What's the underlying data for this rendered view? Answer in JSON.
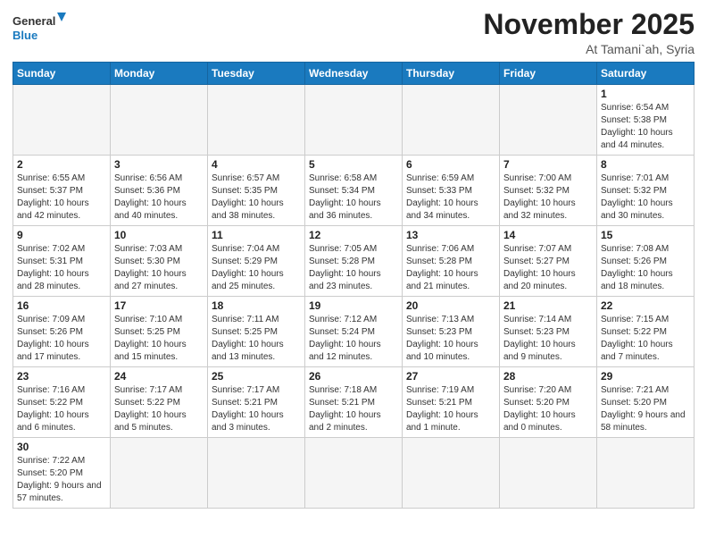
{
  "logo": {
    "line1": "General",
    "line2": "Blue"
  },
  "title": "November 2025",
  "location": "At Tamani`ah, Syria",
  "weekdays": [
    "Sunday",
    "Monday",
    "Tuesday",
    "Wednesday",
    "Thursday",
    "Friday",
    "Saturday"
  ],
  "weeks": [
    [
      {
        "day": "",
        "info": ""
      },
      {
        "day": "",
        "info": ""
      },
      {
        "day": "",
        "info": ""
      },
      {
        "day": "",
        "info": ""
      },
      {
        "day": "",
        "info": ""
      },
      {
        "day": "",
        "info": ""
      },
      {
        "day": "1",
        "info": "Sunrise: 6:54 AM\nSunset: 5:38 PM\nDaylight: 10 hours and 44 minutes."
      }
    ],
    [
      {
        "day": "2",
        "info": "Sunrise: 6:55 AM\nSunset: 5:37 PM\nDaylight: 10 hours and 42 minutes."
      },
      {
        "day": "3",
        "info": "Sunrise: 6:56 AM\nSunset: 5:36 PM\nDaylight: 10 hours and 40 minutes."
      },
      {
        "day": "4",
        "info": "Sunrise: 6:57 AM\nSunset: 5:35 PM\nDaylight: 10 hours and 38 minutes."
      },
      {
        "day": "5",
        "info": "Sunrise: 6:58 AM\nSunset: 5:34 PM\nDaylight: 10 hours and 36 minutes."
      },
      {
        "day": "6",
        "info": "Sunrise: 6:59 AM\nSunset: 5:33 PM\nDaylight: 10 hours and 34 minutes."
      },
      {
        "day": "7",
        "info": "Sunrise: 7:00 AM\nSunset: 5:32 PM\nDaylight: 10 hours and 32 minutes."
      },
      {
        "day": "8",
        "info": "Sunrise: 7:01 AM\nSunset: 5:32 PM\nDaylight: 10 hours and 30 minutes."
      }
    ],
    [
      {
        "day": "9",
        "info": "Sunrise: 7:02 AM\nSunset: 5:31 PM\nDaylight: 10 hours and 28 minutes."
      },
      {
        "day": "10",
        "info": "Sunrise: 7:03 AM\nSunset: 5:30 PM\nDaylight: 10 hours and 27 minutes."
      },
      {
        "day": "11",
        "info": "Sunrise: 7:04 AM\nSunset: 5:29 PM\nDaylight: 10 hours and 25 minutes."
      },
      {
        "day": "12",
        "info": "Sunrise: 7:05 AM\nSunset: 5:28 PM\nDaylight: 10 hours and 23 minutes."
      },
      {
        "day": "13",
        "info": "Sunrise: 7:06 AM\nSunset: 5:28 PM\nDaylight: 10 hours and 21 minutes."
      },
      {
        "day": "14",
        "info": "Sunrise: 7:07 AM\nSunset: 5:27 PM\nDaylight: 10 hours and 20 minutes."
      },
      {
        "day": "15",
        "info": "Sunrise: 7:08 AM\nSunset: 5:26 PM\nDaylight: 10 hours and 18 minutes."
      }
    ],
    [
      {
        "day": "16",
        "info": "Sunrise: 7:09 AM\nSunset: 5:26 PM\nDaylight: 10 hours and 17 minutes."
      },
      {
        "day": "17",
        "info": "Sunrise: 7:10 AM\nSunset: 5:25 PM\nDaylight: 10 hours and 15 minutes."
      },
      {
        "day": "18",
        "info": "Sunrise: 7:11 AM\nSunset: 5:25 PM\nDaylight: 10 hours and 13 minutes."
      },
      {
        "day": "19",
        "info": "Sunrise: 7:12 AM\nSunset: 5:24 PM\nDaylight: 10 hours and 12 minutes."
      },
      {
        "day": "20",
        "info": "Sunrise: 7:13 AM\nSunset: 5:23 PM\nDaylight: 10 hours and 10 minutes."
      },
      {
        "day": "21",
        "info": "Sunrise: 7:14 AM\nSunset: 5:23 PM\nDaylight: 10 hours and 9 minutes."
      },
      {
        "day": "22",
        "info": "Sunrise: 7:15 AM\nSunset: 5:22 PM\nDaylight: 10 hours and 7 minutes."
      }
    ],
    [
      {
        "day": "23",
        "info": "Sunrise: 7:16 AM\nSunset: 5:22 PM\nDaylight: 10 hours and 6 minutes."
      },
      {
        "day": "24",
        "info": "Sunrise: 7:17 AM\nSunset: 5:22 PM\nDaylight: 10 hours and 5 minutes."
      },
      {
        "day": "25",
        "info": "Sunrise: 7:17 AM\nSunset: 5:21 PM\nDaylight: 10 hours and 3 minutes."
      },
      {
        "day": "26",
        "info": "Sunrise: 7:18 AM\nSunset: 5:21 PM\nDaylight: 10 hours and 2 minutes."
      },
      {
        "day": "27",
        "info": "Sunrise: 7:19 AM\nSunset: 5:21 PM\nDaylight: 10 hours and 1 minute."
      },
      {
        "day": "28",
        "info": "Sunrise: 7:20 AM\nSunset: 5:20 PM\nDaylight: 10 hours and 0 minutes."
      },
      {
        "day": "29",
        "info": "Sunrise: 7:21 AM\nSunset: 5:20 PM\nDaylight: 9 hours and 58 minutes."
      }
    ],
    [
      {
        "day": "30",
        "info": "Sunrise: 7:22 AM\nSunset: 5:20 PM\nDaylight: 9 hours and 57 minutes."
      },
      {
        "day": "",
        "info": ""
      },
      {
        "day": "",
        "info": ""
      },
      {
        "day": "",
        "info": ""
      },
      {
        "day": "",
        "info": ""
      },
      {
        "day": "",
        "info": ""
      },
      {
        "day": "",
        "info": ""
      }
    ]
  ]
}
